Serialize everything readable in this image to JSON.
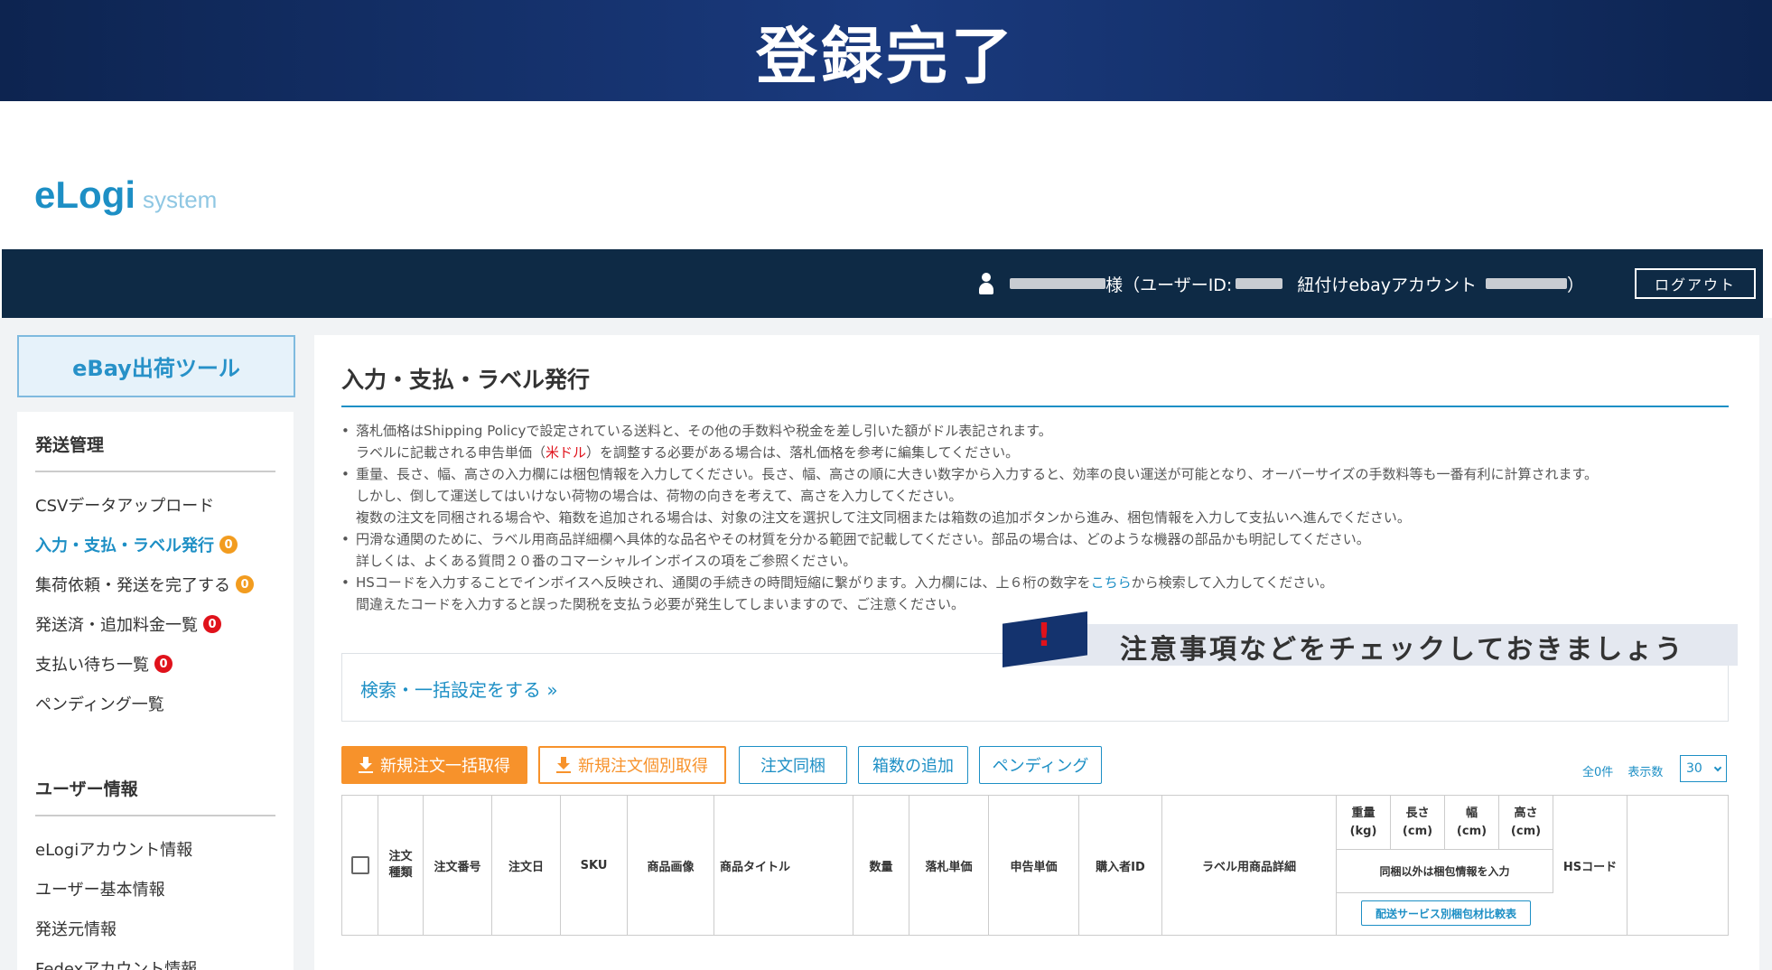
{
  "banner": {
    "title": "登録完了"
  },
  "logo": {
    "main": "eLogi",
    "sub": "system"
  },
  "header": {
    "user_suffix": "様（ユーザーID:",
    "account_label": "紐付けebayアカウント",
    "close_paren": "）",
    "logout_label": "ログアウト"
  },
  "sidebar": {
    "tool_title": "eBay出荷ツール",
    "section1_title": "発送管理",
    "section1_items": [
      {
        "label": "CSVデータアップロード"
      },
      {
        "label": "入力・支払・ラベル発行",
        "badge": "0"
      },
      {
        "label": "集荷依頼・発送を完了する",
        "badge": "0"
      },
      {
        "label": "発送済・追加料金一覧",
        "badge": "0"
      },
      {
        "label": "支払い待ち一覧",
        "badge": "0"
      },
      {
        "label": "ペンディング一覧"
      }
    ],
    "section2_title": "ユーザー情報",
    "section2_items": [
      {
        "label": "eLogiアカウント情報"
      },
      {
        "label": "ユーザー基本情報"
      },
      {
        "label": "発送元情報"
      },
      {
        "label": "Fedexアカウント情報"
      }
    ]
  },
  "main": {
    "title": "入力・支払・ラベル発行",
    "notes": {
      "n1a": "落札価格はShipping Policyで設定されている送料と、その他の手数料や税金を差し引いた額がドル表記されます。",
      "n1b_pre": "ラベルに記載される申告単価（",
      "n1b_red": "米ドル",
      "n1b_post": "）を調整する必要がある場合は、落札価格を参考に編集してください。",
      "n2a": "重量、長さ、幅、高さの入力欄には梱包情報を入力してください。長さ、幅、高さの順に大きい数字から入力すると、効率の良い運送が可能となり、オーバーサイズの手数料等も一番有利に計算されます。",
      "n2b": "しかし、倒して運送してはいけない荷物の場合は、荷物の向きを考えて、高さを入力してください。",
      "n2c": "複数の注文を同梱される場合や、箱数を追加される場合は、対象の注文を選択して注文同梱または箱数の追加ボタンから進み、梱包情報を入力して支払いへ進んでください。",
      "n3a": "円滑な通関のために、ラベル用商品詳細欄へ具体的な品名やその材質を分かる範囲で記載してください。部品の場合は、どのような機器の部品かも明記してください。",
      "n3b": "詳しくは、よくある質問２０番のコマーシャルインボイスの項をご参照ください。",
      "n4a_pre": "HSコードを入力することでインボイスへ反映され、通関の手続きの時間短縮に繋がります。入力欄には、上６桁の数字を",
      "n4a_link": "こちら",
      "n4a_post": "から検索して入力してください。",
      "n4b": "間違えたコードを入力すると誤った関税を支払う必要が発生してしまいますので、ご注意ください。"
    },
    "search_link": "検索・一括設定をする »",
    "callout": "注意事項などをチェックしておきましょう",
    "callout_mark": "!",
    "buttons": {
      "bulk_fetch": "新規注文一括取得",
      "single_fetch": "新規注文個別取得",
      "combine": "注文同梱",
      "add_box": "箱数の追加",
      "pending": "ペンディング"
    },
    "count_total": "全0件",
    "count_display": "表示数",
    "per_page": "30",
    "table": {
      "headers": {
        "order_type": "注文種類",
        "order_no": "注文番号",
        "order_date": "注文日",
        "sku": "SKU",
        "image": "商品画像",
        "item_title": "商品タイトル",
        "qty": "数量",
        "winning_price": "落札単価",
        "declared_price": "申告単価",
        "buyer_id": "購入者ID",
        "label_detail": "ラベル用商品詳細",
        "weight": "重量",
        "weight_unit": "(kg)",
        "length": "長さ",
        "length_unit": "(cm)",
        "width": "幅",
        "width_unit": "(cm)",
        "height": "高さ",
        "height_unit": "(cm)",
        "packing_note": "同梱以外は梱包情報を入力",
        "compare_btn": "配送サービス別梱包材比較表",
        "hs_code": "HSコード"
      }
    }
  }
}
